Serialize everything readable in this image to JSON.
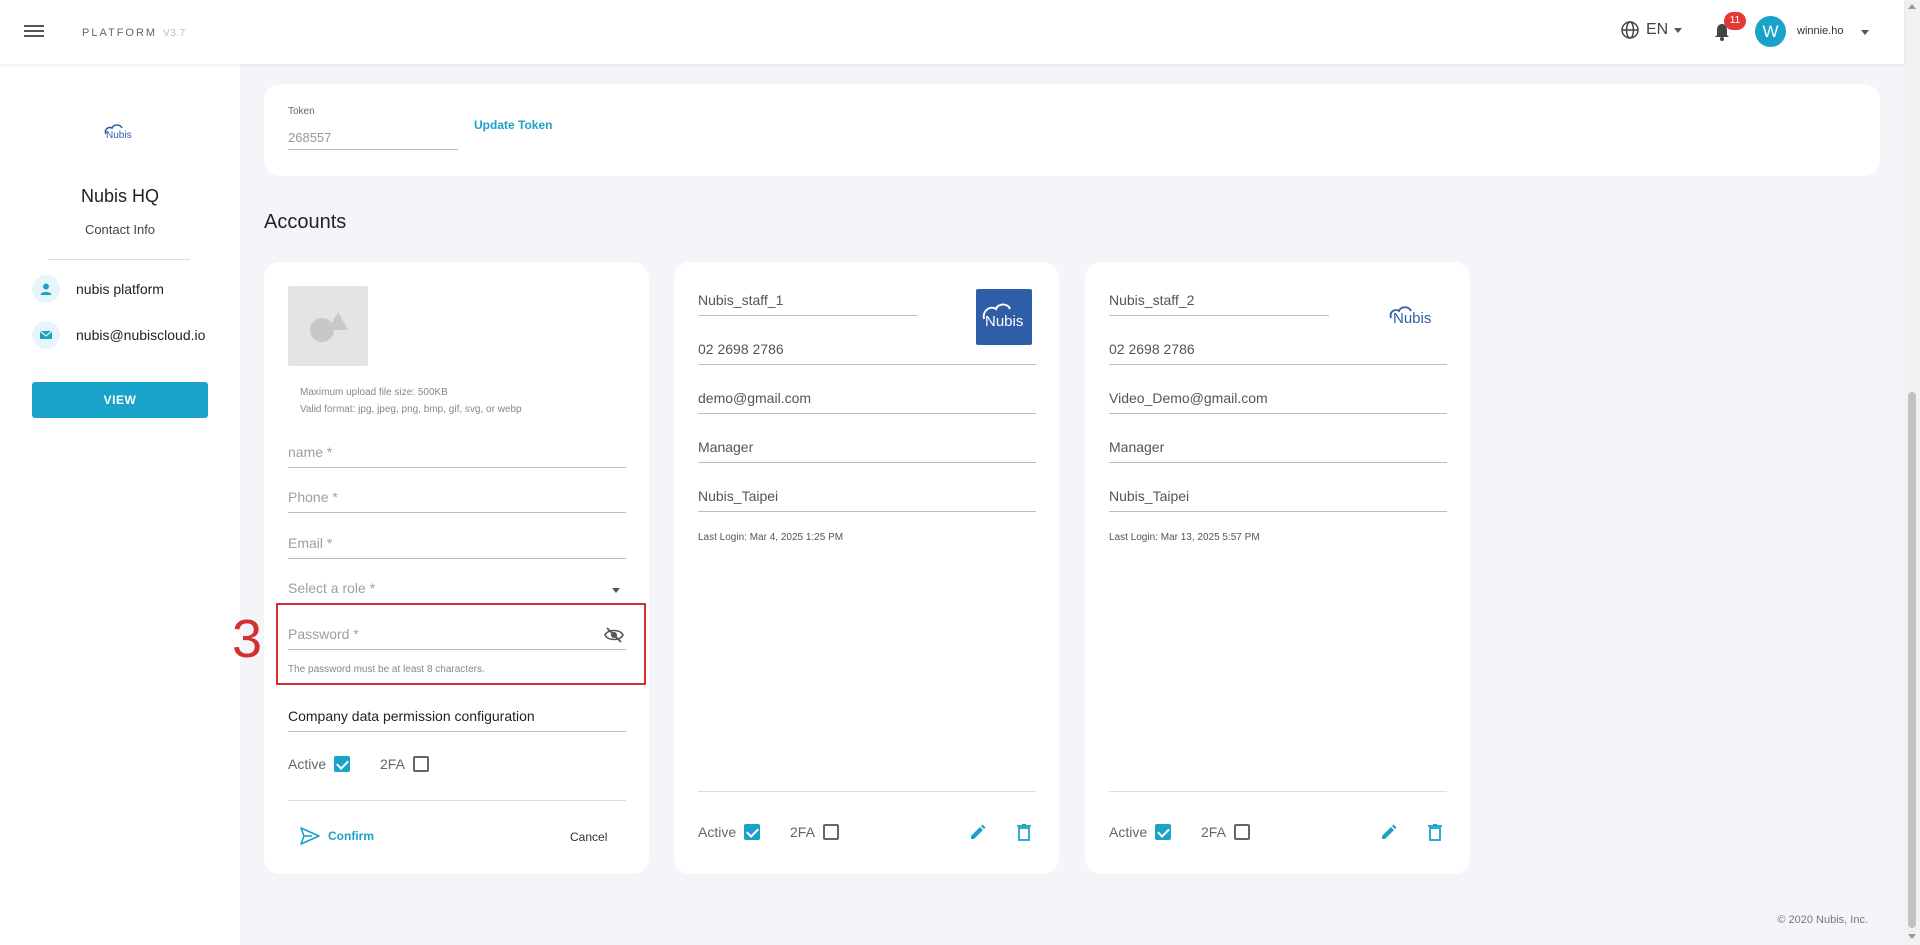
{
  "header": {
    "brand": "PLATFORM",
    "version": "V3.7",
    "language": "EN",
    "notification_count": "11",
    "avatar_initial": "W",
    "username": "winnie.ho"
  },
  "sidebar": {
    "logo_text": "Nubis",
    "company_name": "Nubis HQ",
    "contact_info_label": "Contact Info",
    "contact_name": "nubis platform",
    "contact_email": "nubis@nubiscloud.io",
    "view_button": "VIEW"
  },
  "token": {
    "label": "Token",
    "value": "268557",
    "update_label": "Update Token"
  },
  "accounts": {
    "title": "Accounts",
    "new_account_form": {
      "upload_hint_size": "Maximum upload file size: 500KB",
      "upload_hint_format": "Valid format: jpg, jpeg, png, bmp, gif, svg, or webp",
      "name_placeholder": "name *",
      "phone_placeholder": "Phone *",
      "email_placeholder": "Email *",
      "role_placeholder": "Select a role *",
      "password_placeholder": "Password *",
      "password_hint": "The password must be at least 8 characters.",
      "permission_config": "Company data permission configuration",
      "active_label": "Active",
      "active_checked": true,
      "twofa_label": "2FA",
      "twofa_checked": false,
      "confirm_label": "Confirm",
      "cancel_label": "Cancel"
    },
    "cards": [
      {
        "name": "Nubis_staff_1",
        "phone": "02 2698 2786",
        "email": "demo@gmail.com",
        "role": "Manager",
        "location": "Nubis_Taipei",
        "last_login": "Last Login: Mar 4, 2025 1:25 PM",
        "active_label": "Active",
        "active_checked": true,
        "twofa_label": "2FA",
        "twofa_checked": false
      },
      {
        "name": "Nubis_staff_2",
        "phone": "02 2698 2786",
        "email": "Video_Demo@gmail.com",
        "role": "Manager",
        "location": "Nubis_Taipei",
        "last_login": "Last Login: Mar 13, 2025 5:57 PM",
        "active_label": "Active",
        "active_checked": true,
        "twofa_label": "2FA",
        "twofa_checked": false
      }
    ]
  },
  "annotation": {
    "step_number": "3",
    "color": "#d32f2f"
  },
  "footer": "© 2020 Nubis, Inc.",
  "colors": {
    "accent": "#1aa3c8",
    "badge": "#e53935",
    "logo_blue": "#2f5ea8"
  }
}
